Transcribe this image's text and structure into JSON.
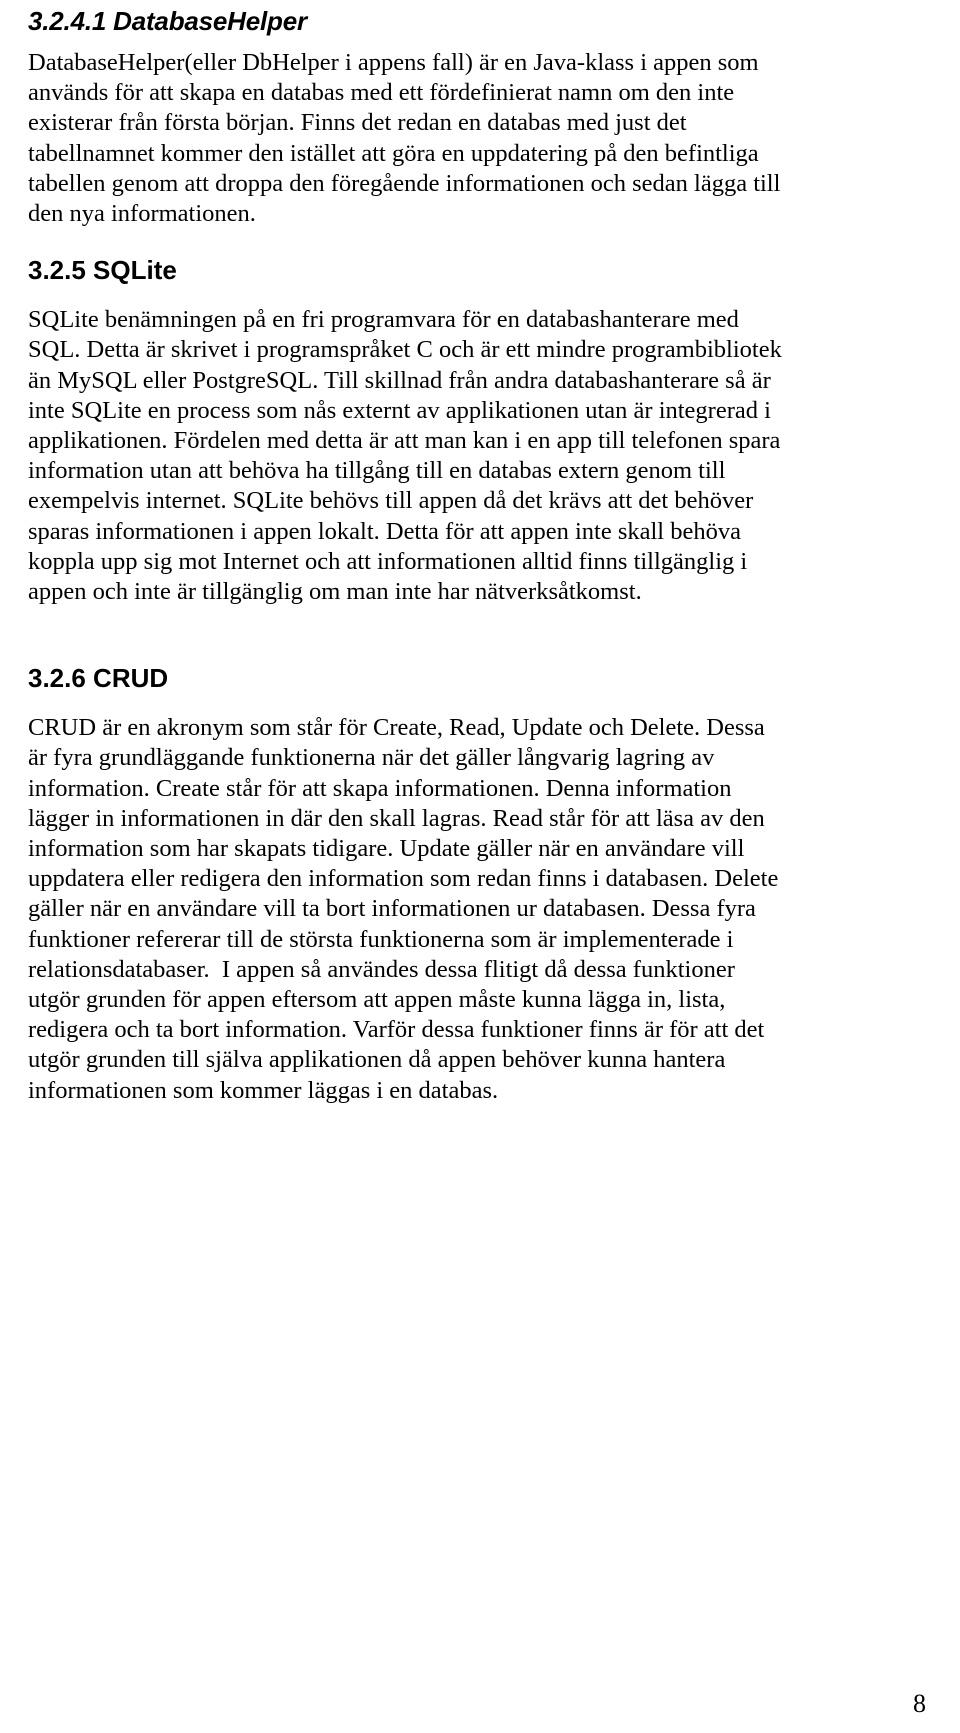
{
  "page": {
    "number": "8",
    "language": "sv"
  },
  "sections": [
    {
      "id": "databasehelper",
      "heading_number": "3.2.4.1",
      "heading_title": "DatabaseHelper",
      "heading_full": "3.2.4.1 DatabaseHelper",
      "body": "DatabaseHelper(eller DbHelper i appens fall) är en Java-klass i appen som\nanvänds för att skapa en databas med ett fördefinierat namn om den inte\nexisterar från första början. Finns det redan en databas med just det\ntabellnamnet kommer den istället att göra en uppdatering på den befintliga\ntabellen genom att droppa den föregående informationen och sedan lägga till\nden nya informationen."
    },
    {
      "id": "sqlite",
      "heading_number": "3.2.5",
      "heading_title": "SQLite",
      "heading_full": "3.2.5   SQLite",
      "body": "SQLite benämningen på en fri programvara för en databashanterare med\nSQL. Detta är skrivet i programspråket C och är ett mindre programbibliotek\nän MySQL eller PostgreSQL. Till skillnad från andra databashanterare så är\ninte SQLite en process som nås externt av applikationen utan är integrerad i\napplikationen. Fördelen med detta är att man kan i en app till telefonen spara\ninformation utan att behöva ha tillgång till en databas extern genom till\nexempelvis internet. SQLite behövs till appen då det krävs att det behöver\nsparas informationen i appen lokalt. Detta för att appen inte skall behöva\nkoppla upp sig mot Internet och att informationen alltid finns tillgänglig i\nappen och inte är tillgänglig om man inte har nätverksåtkomst."
    },
    {
      "id": "crud",
      "heading_number": "3.2.6",
      "heading_title": "CRUD",
      "heading_full": "3.2.6   CRUD",
      "body": "CRUD är en akronym som står för Create, Read, Update och Delete. Dessa\när fyra grundläggande funktionerna när det gäller långvarig lagring av\ninformation. Create står för att skapa informationen. Denna information\nlägger in informationen in där den skall lagras. Read står för att läsa av den\ninformation som har skapats tidigare. Update gäller när en användare vill\nuppdatera eller redigera den information som redan finns i databasen. Delete\ngäller när en användare vill ta bort informationen ur databasen. Dessa fyra\nfunktioner refererar till de största funktionerna som är implementerade i\nrelationsdatabaser.  I appen så användes dessa flitigt då dessa funktioner\nutgör grunden för appen eftersom att appen måste kunna lägga in, lista,\nredigera och ta bort information. Varför dessa funktioner finns är för att det\nutgör grunden till själva applikationen då appen behöver kunna hantera\ninformationen som kommer läggas i en databas."
    }
  ]
}
